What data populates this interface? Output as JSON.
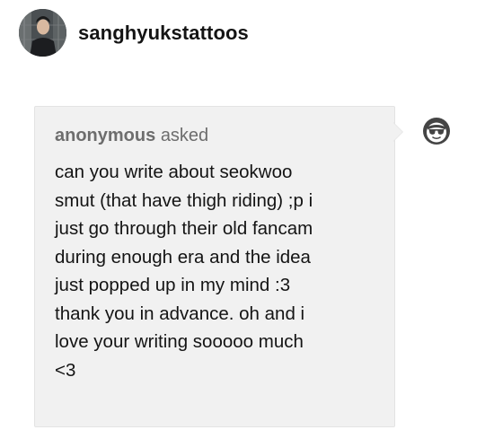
{
  "post": {
    "username": "sanghyukstattoos",
    "avatar_icon": "profile-photo"
  },
  "ask": {
    "asker_name": "anonymous",
    "asked_label": "asked",
    "question_lines": [
      "can you write about seokwoo",
      "smut (that have thigh riding) ;p i",
      "just go through their old fancam",
      "during enough era and the idea",
      "just popped up in my mind :3",
      "thank you in advance. oh and i",
      "love your writing sooooo much",
      "<3"
    ],
    "asker_icon": "anonymous-sunglasses-icon"
  },
  "colors": {
    "ask_background": "#f1f1f1",
    "asker_text": "#6d6d6d",
    "body_text": "#141414"
  }
}
